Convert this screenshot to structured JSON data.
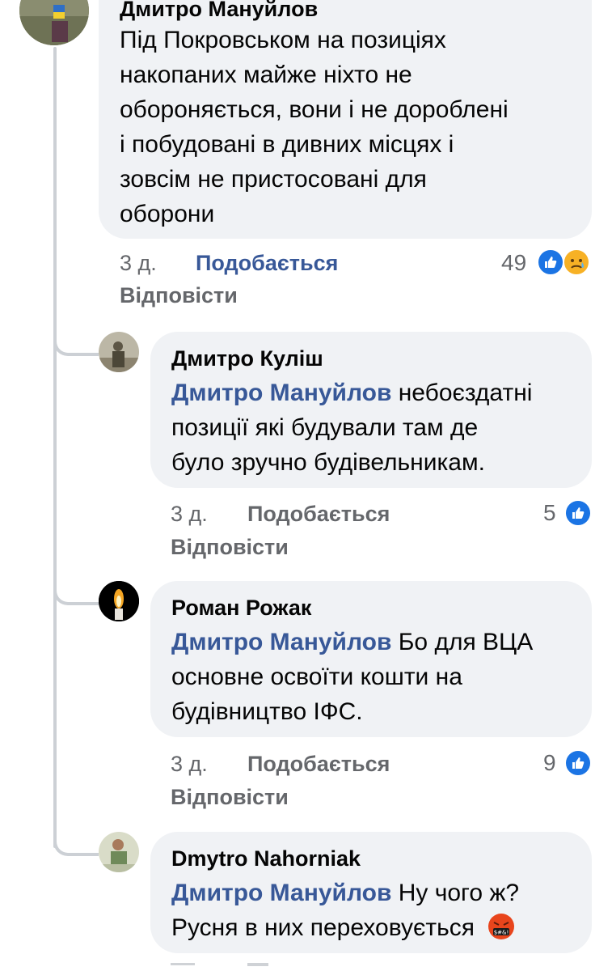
{
  "comments": [
    {
      "author": "Дмитро Мануйлов",
      "lines": [
        "Під Покровськом на позиціях",
        "накопаних майже ніхто не",
        "обороняється, вони і не доробленi",
        "і побудовані в дивних місцях і",
        "зовсім не пристосовані для",
        "оборони"
      ],
      "time": "3 д.",
      "like_label": "Подобається",
      "reply_label": "Відповісти",
      "reaction_count": "49",
      "reactions": [
        "like-icon",
        "sad-icon"
      ]
    },
    {
      "author": "Дмитро Куліш",
      "mention": "Дмитро Мануйлов",
      "first_line_rest": " небоєздатні",
      "lines": [
        "позиції які будували там де",
        "було зручно будівельникам."
      ],
      "time": "3 д.",
      "like_label": "Подобається",
      "reply_label": "Відповісти",
      "reaction_count": "5",
      "reactions": [
        "like-icon"
      ]
    },
    {
      "author": "Роман Рожак",
      "mention": "Дмитро Мануйлов",
      "first_line_rest": " Бо для ВЦА",
      "lines": [
        "основне освоїти кошти на",
        "будівництво ІФС."
      ],
      "time": "3 д.",
      "like_label": "Подобається",
      "reply_label": "Відповісти",
      "reaction_count": "9",
      "reactions": [
        "like-icon"
      ]
    },
    {
      "author": "Dmytro Nahorniak",
      "mention": "Дмитро Мануйлов",
      "first_line_rest": " Ну чого ж?",
      "lines": [
        "Русня в них переховується"
      ],
      "emoji": "swearing-face-icon"
    }
  ],
  "colors": {
    "bubble": "#f0f2f5",
    "mention": "#385898",
    "meta": "#65676b",
    "like_reaction": "#1b74e4",
    "thread_line": "#ccd0d5"
  }
}
